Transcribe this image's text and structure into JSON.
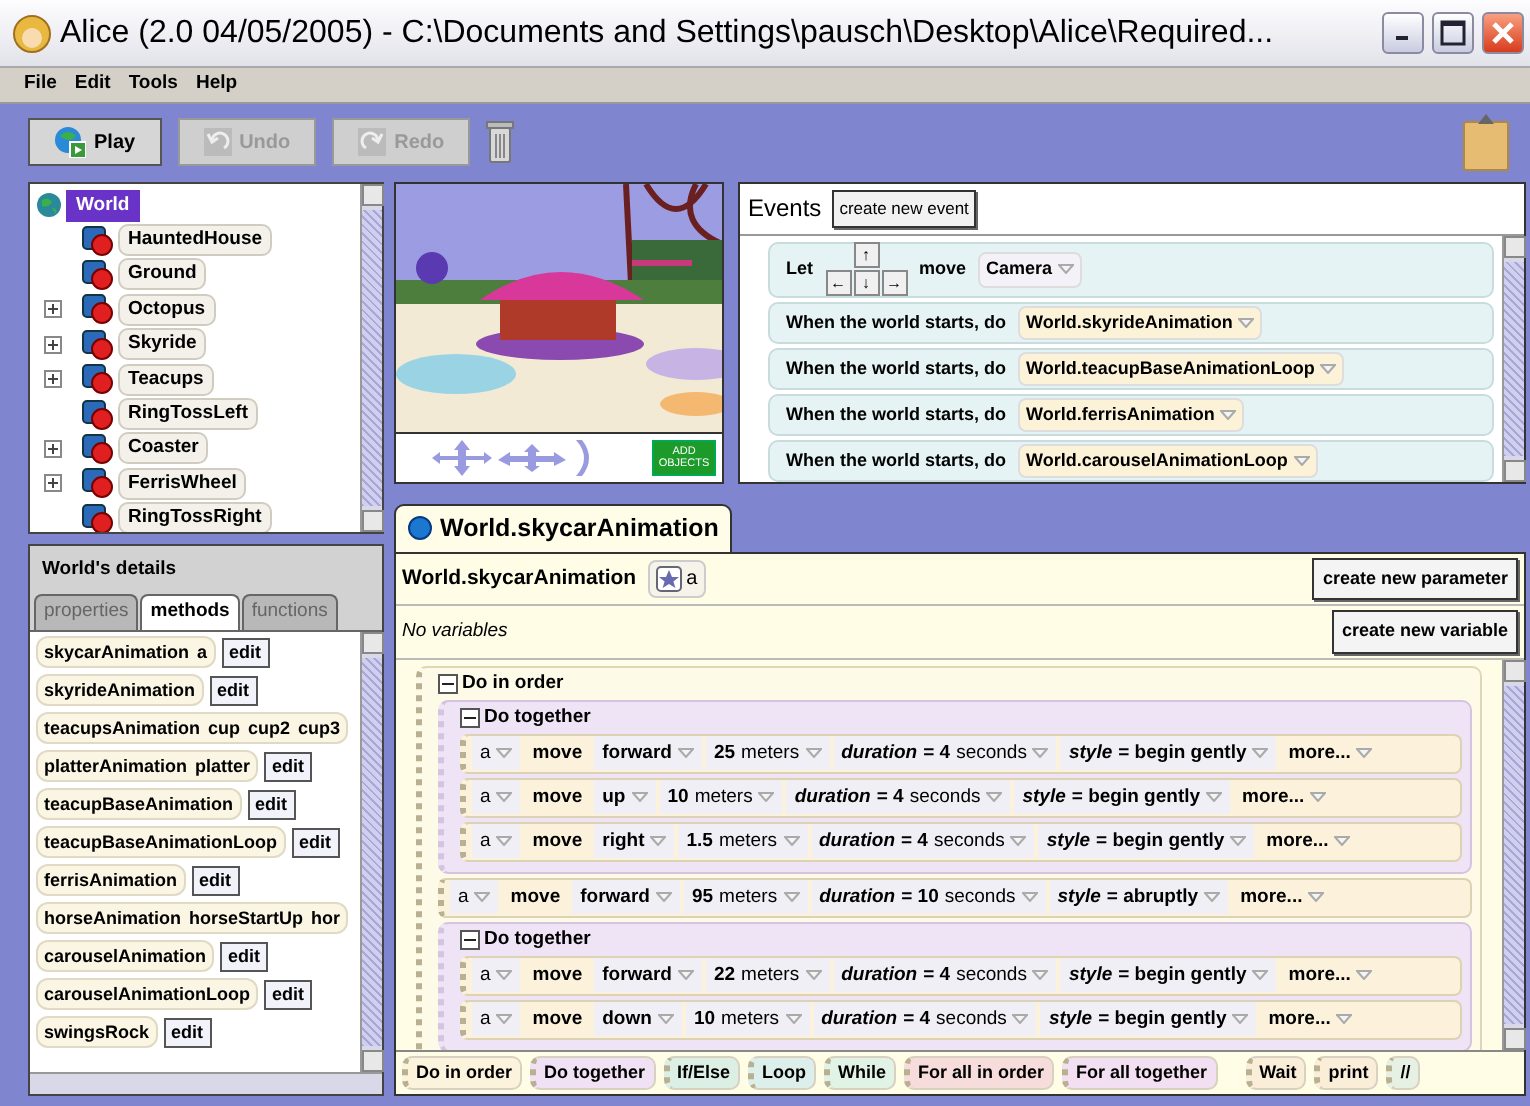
{
  "window": {
    "title": "Alice (2.0 04/05/2005) - C:\\Documents and Settings\\pausch\\Desktop\\Alice\\Required..."
  },
  "menu": [
    "File",
    "Edit",
    "Tools",
    "Help"
  ],
  "toolbar": [
    {
      "label": "Play",
      "disabled": false
    },
    {
      "label": "Undo",
      "disabled": true
    },
    {
      "label": "Redo",
      "disabled": true
    }
  ],
  "object_tree": {
    "label": "World",
    "kind": "world",
    "selected": true,
    "children": [
      {
        "label": "HauntedHouse",
        "kind": "object",
        "selected": false,
        "expandable": false
      },
      {
        "label": "Ground",
        "kind": "object",
        "selected": false,
        "expandable": false
      },
      {
        "label": "Octopus",
        "kind": "object",
        "selected": false,
        "expandable": true
      },
      {
        "label": "Skyride",
        "kind": "object",
        "selected": false,
        "expandable": true
      },
      {
        "label": "Teacups",
        "kind": "object",
        "selected": false,
        "expandable": true
      },
      {
        "label": "RingTossLeft",
        "kind": "object",
        "selected": false,
        "expandable": false
      },
      {
        "label": "Coaster",
        "kind": "object",
        "selected": false,
        "expandable": true
      },
      {
        "label": "FerrisWheel",
        "kind": "object",
        "selected": false,
        "expandable": true
      },
      {
        "label": "RingTossRight",
        "kind": "object",
        "selected": false,
        "expandable": false
      }
    ]
  },
  "details": {
    "title": "World's details",
    "tabs": [
      {
        "label": "properties",
        "selected": false
      },
      {
        "label": "methods",
        "selected": true
      },
      {
        "label": "functions",
        "selected": false
      }
    ],
    "methods": [
      {
        "name": "skycarAnimation",
        "params": [
          "a"
        ],
        "edit": "edit"
      },
      {
        "name": "skyrideAnimation",
        "edit": "edit"
      },
      {
        "name": "teacupsAnimation",
        "params": [
          "cup",
          "cup2",
          "cup3"
        ]
      },
      {
        "name": "platterAnimation",
        "params": [
          "platter"
        ],
        "edit": "edit"
      },
      {
        "name": "teacupBaseAnimation",
        "edit": "edit"
      },
      {
        "name": "teacupBaseAnimationLoop",
        "edit": "edit"
      },
      {
        "name": "ferrisAnimation",
        "edit": "edit"
      },
      {
        "name": "horseAnimation",
        "params": [
          "horseStartUp",
          "hor"
        ]
      },
      {
        "name": "carouselAnimation",
        "edit": "edit"
      },
      {
        "name": "carouselAnimationLoop",
        "edit": "edit"
      },
      {
        "name": "swingsRock",
        "edit": "edit"
      }
    ]
  },
  "scene": {
    "add_objects": "ADD OBJECTS"
  },
  "events": {
    "title": "Events",
    "create_button": "create new event",
    "rows": [
      {
        "kind": "keys",
        "let": "Let",
        "keys": [
          "↑",
          "←",
          "↓",
          "→"
        ],
        "verb": "move",
        "target": "Camera"
      },
      {
        "kind": "start",
        "text": "When the world starts,  do",
        "method": "World.skyrideAnimation"
      },
      {
        "kind": "start",
        "text": "When the world starts,  do",
        "method": "World.teacupBaseAnimationLoop"
      },
      {
        "kind": "start",
        "text": "When the world starts,  do",
        "method": "World.ferrisAnimation"
      },
      {
        "kind": "start",
        "text": "When the world starts,  do",
        "method": "World.carouselAnimationLoop"
      }
    ]
  },
  "editor": {
    "tab": "World.skycarAnimation",
    "method": "World.skycarAnimation",
    "param": "a",
    "no_variables": "No variables",
    "parameter_button": "create new parameter",
    "variable_button": "create new variable",
    "code": [
      {
        "kind": "do_in_order",
        "label": "Do in order",
        "expanded": true,
        "children": [
          {
            "kind": "do_together",
            "label": "Do together",
            "expanded": true,
            "children": [
              {
                "kind": "move",
                "object": "a",
                "verb": "move",
                "direction": "forward",
                "amount": "25",
                "unit": "meters",
                "duration_label": "duration",
                "duration": "= 4",
                "duration_unit": "seconds",
                "style_label": "style",
                "style": "= begin gently",
                "more": "more..."
              },
              {
                "kind": "move",
                "object": "a",
                "verb": "move",
                "direction": "up",
                "amount": "10",
                "unit": "meters",
                "duration_label": "duration",
                "duration": "= 4",
                "duration_unit": "seconds",
                "style_label": "style",
                "style": "= begin gently",
                "more": "more..."
              },
              {
                "kind": "move",
                "object": "a",
                "verb": "move",
                "direction": "right",
                "amount": "1.5",
                "unit": "meters",
                "duration_label": "duration",
                "duration": "= 4",
                "duration_unit": "seconds",
                "style_label": "style",
                "style": "= begin gently",
                "more": "more..."
              }
            ]
          },
          {
            "kind": "move",
            "object": "a",
            "verb": "move",
            "direction": "forward",
            "amount": "95",
            "unit": "meters",
            "duration_label": "duration",
            "duration": "= 10",
            "duration_unit": "seconds",
            "style_label": "style",
            "style": "= abruptly",
            "more": "more..."
          },
          {
            "kind": "do_together",
            "label": "Do together",
            "expanded": true,
            "children": [
              {
                "kind": "move",
                "object": "a",
                "verb": "move",
                "direction": "forward",
                "amount": "22",
                "unit": "meters",
                "duration_label": "duration",
                "duration": "= 4",
                "duration_unit": "seconds",
                "style_label": "style",
                "style": "= begin gently",
                "more": "more..."
              },
              {
                "kind": "move",
                "object": "a",
                "verb": "move",
                "direction": "down",
                "amount": "10",
                "unit": "meters",
                "duration_label": "duration",
                "duration": "= 4",
                "duration_unit": "seconds",
                "style_label": "style",
                "style": "= begin gently",
                "more": "more..."
              }
            ]
          }
        ]
      }
    ],
    "palette": [
      {
        "label": "Do in order",
        "color": "#fbf3dc"
      },
      {
        "label": "Do together",
        "color": "#f0e2f4"
      },
      {
        "label": "If/Else",
        "color": "#dcefe4"
      },
      {
        "label": "Loop",
        "color": "#dcefea"
      },
      {
        "label": "While",
        "color": "#e0f3e4"
      },
      {
        "label": "For all in order",
        "color": "#f7dcdc"
      },
      {
        "label": "For all together",
        "color": "#f2e0f2"
      },
      {
        "label": "Wait",
        "color": "#faeed8"
      },
      {
        "label": "print",
        "color": "#faeed8"
      },
      {
        "label": "//",
        "color": "#e6f1e4"
      }
    ]
  }
}
